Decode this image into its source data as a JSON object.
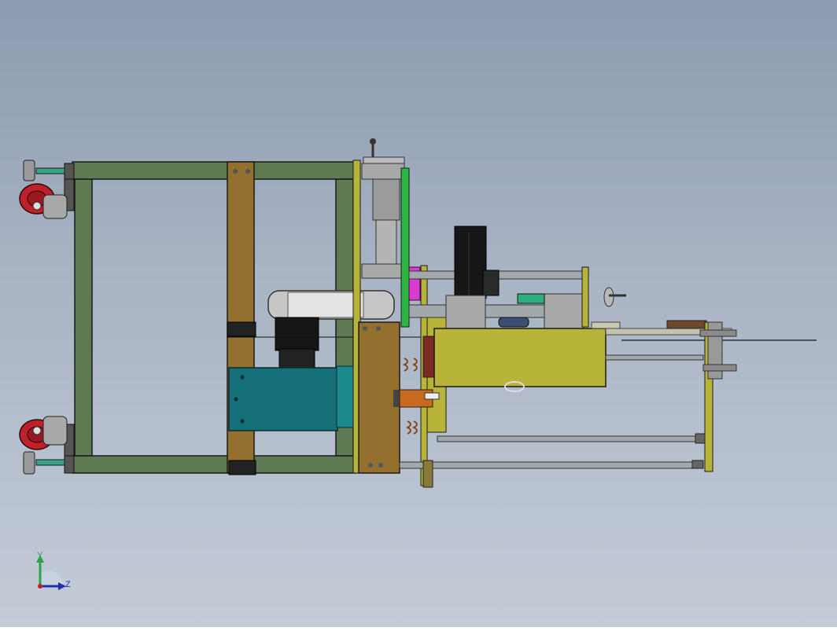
{
  "viewport": {
    "background_top": "#8c9bb0",
    "background_bottom": "#c4ccd7"
  },
  "colors": {
    "frame": "#5e7a52",
    "post": "#93702e",
    "plate": "#b8b43a",
    "motor": "#16707a",
    "wheel": "#c0202a",
    "rod": "#9ea3a8",
    "magenta": "#d93cd0",
    "green_panel": "#2bb542"
  },
  "triad": {
    "y_label": "Y",
    "z_label": "Z",
    "y_color": "#2aa44a",
    "z_color": "#2233aa"
  }
}
